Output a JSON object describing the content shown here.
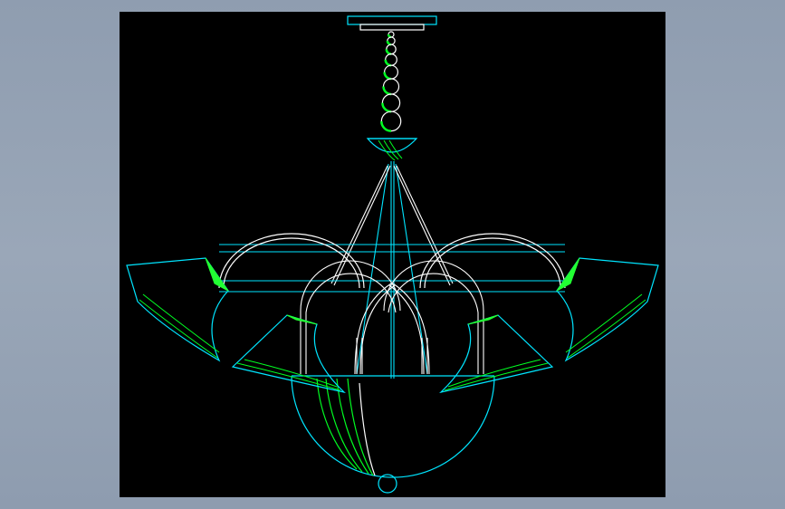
{
  "app": {
    "window_title": ""
  },
  "canvas": {
    "background": "#000000",
    "surround": "#98a5b6"
  },
  "colors": {
    "cyan": "#00e5ff",
    "white": "#ffffff",
    "green": "#00ff22",
    "bright_green": "#22ff33"
  },
  "drawing": {
    "subject": "chandelier-elevation",
    "arms": 5,
    "chain_links": 8
  }
}
